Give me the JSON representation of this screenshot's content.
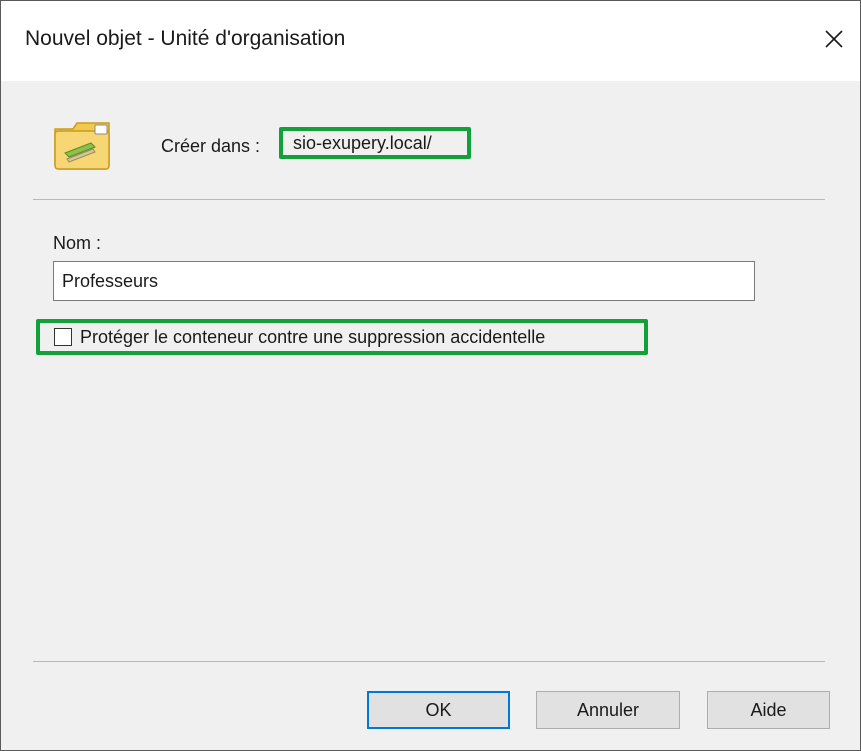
{
  "window": {
    "title": "Nouvel objet - Unité d'organisation"
  },
  "header": {
    "icon": "organizational-unit-folder-icon",
    "create_in_label": "Créer dans :",
    "location": "sio-exupery.local/"
  },
  "form": {
    "name_label": "Nom :",
    "name_value": "Professeurs",
    "protect_label": "Protéger le conteneur contre une suppression accidentelle",
    "protect_checked": false
  },
  "buttons": {
    "ok": "OK",
    "cancel": "Annuler",
    "help": "Aide"
  },
  "colors": {
    "highlight": "#12a03a",
    "focus": "#0078d7"
  }
}
